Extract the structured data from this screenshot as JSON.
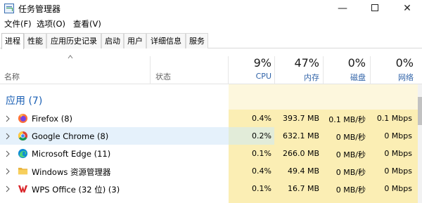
{
  "window": {
    "title": "任务管理器",
    "minimize_glyph": "—",
    "close_glyph": "✕"
  },
  "menu": [
    {
      "label": "文件(F)"
    },
    {
      "label": "选项(O)"
    },
    {
      "label": "查看(V)"
    }
  ],
  "tabs": [
    {
      "label": "进程",
      "active": true
    },
    {
      "label": "性能"
    },
    {
      "label": "应用历史记录"
    },
    {
      "label": "启动"
    },
    {
      "label": "用户"
    },
    {
      "label": "详细信息"
    },
    {
      "label": "服务"
    }
  ],
  "columns": {
    "name": {
      "label": "名称"
    },
    "status": {
      "label": "状态"
    },
    "cpu": {
      "pct": "9%",
      "label": "CPU"
    },
    "memory": {
      "pct": "47%",
      "label": "内存"
    },
    "disk": {
      "pct": "0%",
      "label": "磁盘"
    },
    "network": {
      "pct": "0%",
      "label": "网络"
    }
  },
  "group": {
    "title": "应用 (7)"
  },
  "processes": [
    {
      "name": "Firefox (8)",
      "icon": "firefox-icon",
      "cpu": "0.4%",
      "memory": "393.7 MB",
      "disk": "0.1 MB/秒",
      "network": "0.1 Mbps"
    },
    {
      "name": "Google Chrome (8)",
      "icon": "chrome-icon",
      "cpu": "0.2%",
      "memory": "632.1 MB",
      "disk": "0 MB/秒",
      "network": "0 Mbps"
    },
    {
      "name": "Microsoft Edge (11)",
      "icon": "edge-icon",
      "cpu": "0.1%",
      "memory": "266.0 MB",
      "disk": "0 MB/秒",
      "network": "0 Mbps"
    },
    {
      "name": "Windows 资源管理器",
      "icon": "folder-icon",
      "cpu": "0.4%",
      "memory": "49.4 MB",
      "disk": "0 MB/秒",
      "network": "0 Mbps"
    },
    {
      "name": "WPS Office (32 位) (3)",
      "icon": "wps-icon",
      "cpu": "0.1%",
      "memory": "16.7 MB",
      "disk": "0 MB/秒",
      "network": "0 Mbps"
    }
  ],
  "colors": {
    "accent": "#1a5fb4",
    "heat_light": "#fdf7dd",
    "heat_mid": "#fbeeb4",
    "hover_row": "#e5f1fb"
  }
}
